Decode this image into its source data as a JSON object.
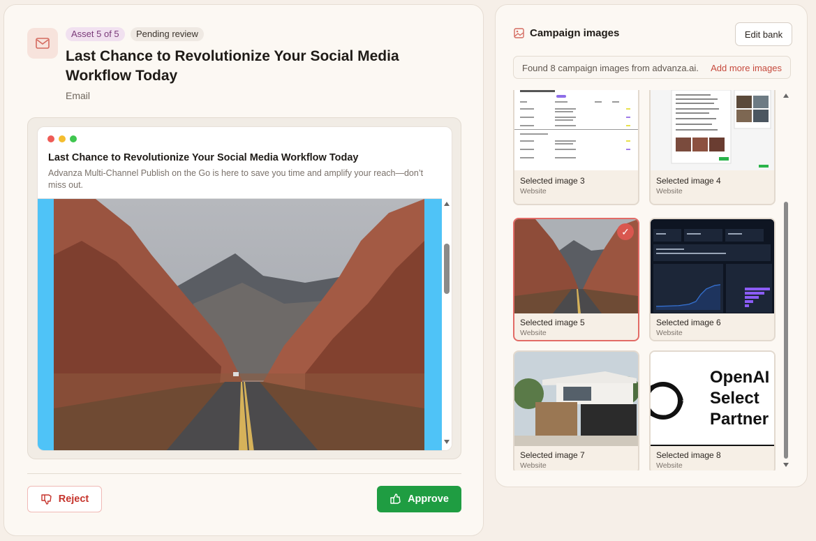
{
  "asset": {
    "counter_badge": "Asset 5 of 5",
    "status_badge": "Pending review",
    "title": "Last Chance to Revolutionize Your Social Media Workflow Today",
    "channel": "Email"
  },
  "email": {
    "subject": "Last Chance to Revolutionize Your Social Media Workflow Today",
    "preview_text": "Advanza Multi-Channel Publish on the Go is here to save you time and amplify your reach—don’t miss out.",
    "hero_image": "desert-road-canyon"
  },
  "actions": {
    "reject_label": "Reject",
    "approve_label": "Approve"
  },
  "campaign_images": {
    "heading": "Campaign images",
    "edit_label": "Edit bank",
    "found_text": "Found 8 campaign images from advanza.ai.",
    "add_more_label": "Add more images",
    "images": [
      {
        "label": "Selected image 3",
        "source": "Website",
        "selected": false
      },
      {
        "label": "Selected image 4",
        "source": "Website",
        "selected": false
      },
      {
        "label": "Selected image 5",
        "source": "Website",
        "selected": true
      },
      {
        "label": "Selected image 6",
        "source": "Website",
        "selected": false
      },
      {
        "label": "Selected image 7",
        "source": "Website",
        "selected": false
      },
      {
        "label": "Selected image 8",
        "source": "Website",
        "selected": false
      }
    ],
    "logo_text": [
      "OpenAI",
      "Select",
      "Partner"
    ]
  },
  "colors": {
    "approve": "#1f9d42",
    "reject": "#c6342c",
    "selected_border": "#e26b66",
    "hero_background": "#4fc3f7"
  }
}
